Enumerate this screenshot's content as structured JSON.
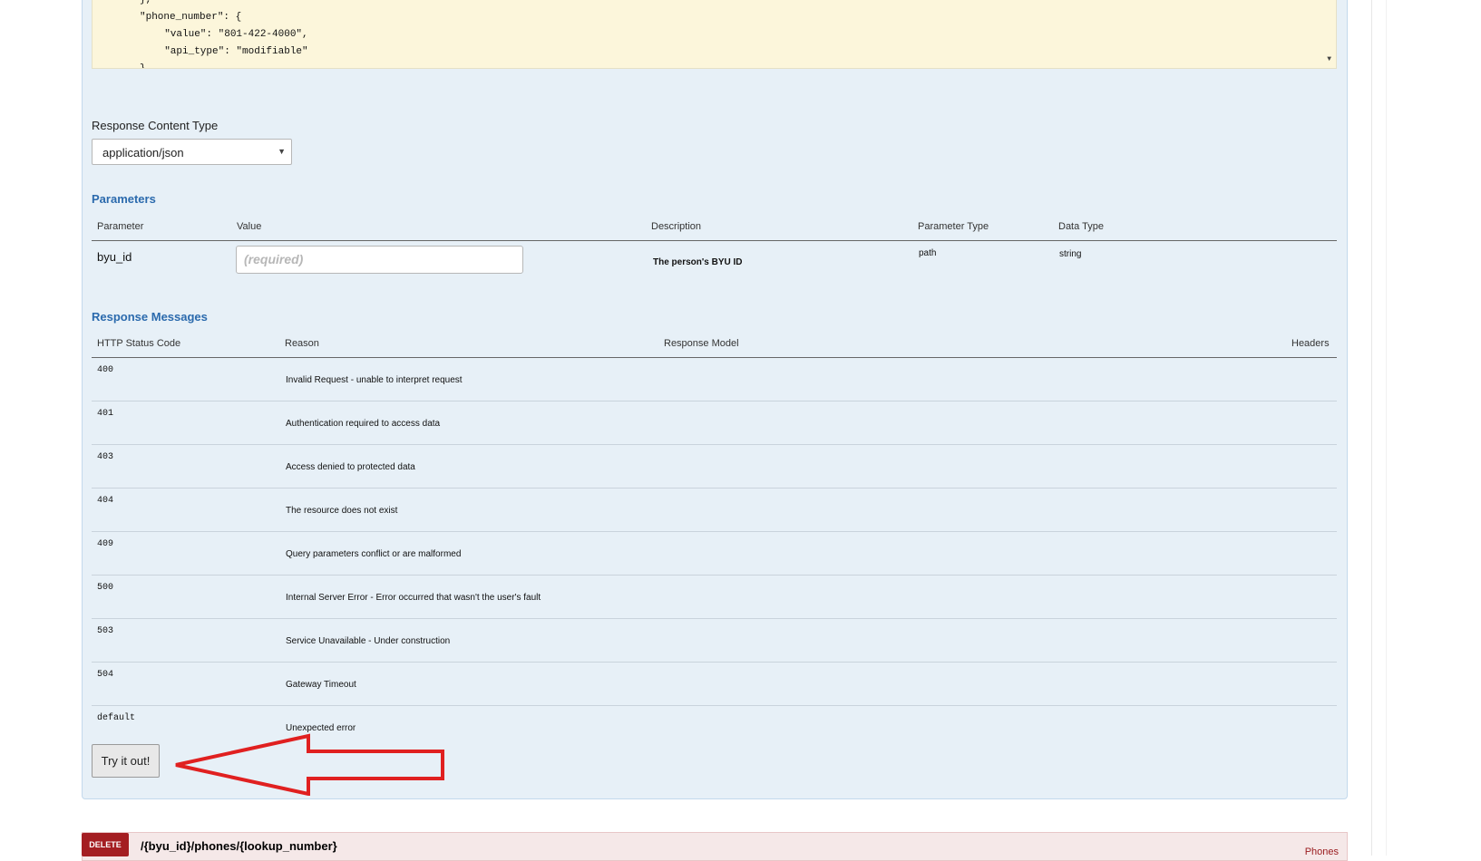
{
  "code_snippet": {
    "lines": [
      "},",
      "\"phone_number\": {",
      "  \"value\": \"801-422-4000\",",
      "  \"api_type\": \"modifiable\"",
      "}"
    ]
  },
  "response_content_type": {
    "label": "Response Content Type",
    "selected": "application/json"
  },
  "parameters": {
    "title": "Parameters",
    "headers": [
      "Parameter",
      "Value",
      "Description",
      "Parameter Type",
      "Data Type"
    ],
    "rows": [
      {
        "name": "byu_id",
        "placeholder": "(required)",
        "description": "The person's BYU ID",
        "param_type": "path",
        "data_type": "string"
      }
    ]
  },
  "response_messages": {
    "title": "Response Messages",
    "headers": [
      "HTTP Status Code",
      "Reason",
      "Response Model",
      "Headers"
    ],
    "rows": [
      {
        "code": "400",
        "reason": "Invalid Request - unable to interpret request"
      },
      {
        "code": "401",
        "reason": "Authentication required to access data"
      },
      {
        "code": "403",
        "reason": "Access denied to protected data"
      },
      {
        "code": "404",
        "reason": "The resource does not exist"
      },
      {
        "code": "409",
        "reason": "Query parameters conflict or are malformed"
      },
      {
        "code": "500",
        "reason": "Internal Server Error - Error occurred that wasn't the user's fault"
      },
      {
        "code": "503",
        "reason": "Service Unavailable - Under construction"
      },
      {
        "code": "504",
        "reason": "Gateway Timeout"
      },
      {
        "code": "default",
        "reason": "Unexpected error"
      }
    ]
  },
  "try_button": {
    "label": "Try it out!"
  },
  "delete_endpoint": {
    "method": "DELETE",
    "path": "/{byu_id}/phones/{lookup_number}",
    "tag": "Phones"
  },
  "colors": {
    "panel_bg": "#e7f0f7",
    "section_title": "#2b6aad",
    "delete_badge": "#a41e22",
    "annotation_arrow": "#e02020"
  }
}
